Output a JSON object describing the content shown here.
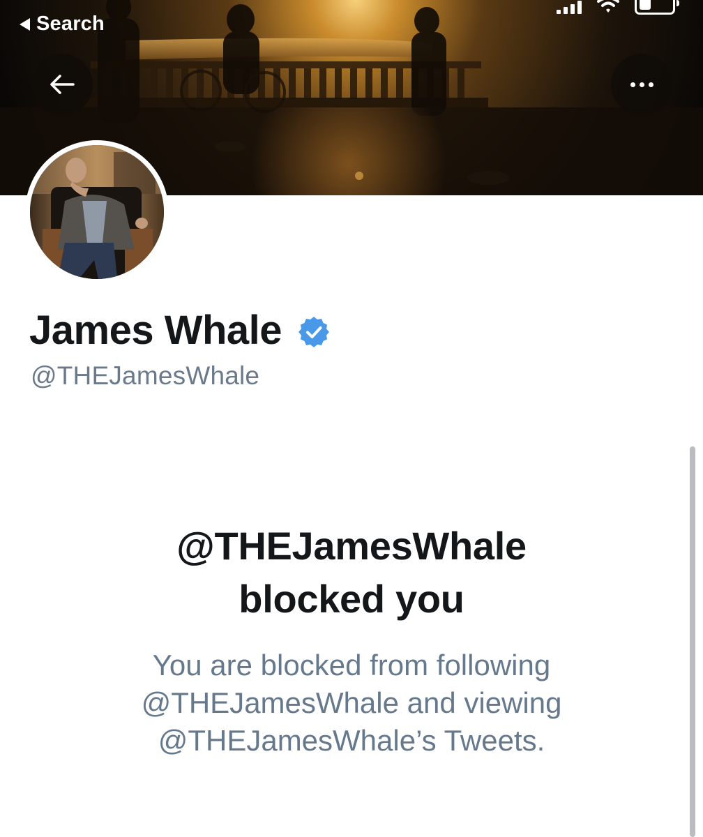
{
  "status_bar": {
    "back_label": "Search"
  },
  "header": {
    "back_icon": "arrow-left-icon",
    "more_icon": "more-horizontal-icon"
  },
  "profile": {
    "display_name": "James Whale",
    "handle": "@THEJamesWhale",
    "verified": true,
    "verified_color": "#4a99e9"
  },
  "blocked_notice": {
    "title_line1": "@THEJamesWhale",
    "title_line2": "blocked you",
    "description_line1": "You are blocked from following",
    "description_line2": "@THEJamesWhale and viewing",
    "description_line3": "@THEJamesWhale’s Tweets."
  },
  "colors": {
    "primary_text": "#14171a",
    "secondary_text": "#6a7a8b",
    "verified_blue": "#4a99e9",
    "background": "#ffffff"
  }
}
